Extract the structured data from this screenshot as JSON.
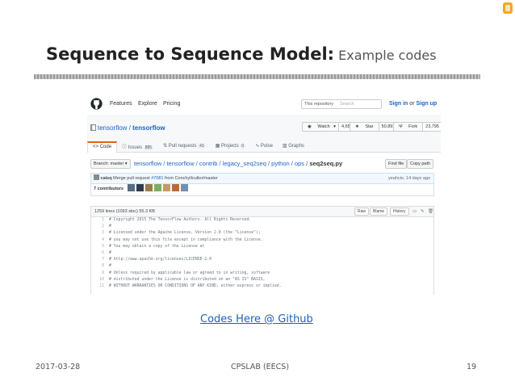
{
  "slide": {
    "title_main": "Sequence to Sequence Model",
    "title_colon": ":",
    "title_sub": " Example codes",
    "link_text": "Codes Here @ Github",
    "footer_date": "2017-03-28",
    "footer_org": "CPSLAB (EECS)",
    "footer_page": "19",
    "accent_color": "#1f5fbf"
  },
  "github": {
    "nav": [
      "Features",
      "Explore",
      "Pricing"
    ],
    "search_scope": "This repository",
    "search_placeholder": "Search",
    "signin": "Sign in",
    "or": "or",
    "signup": "Sign up",
    "repo_owner": "tensorflow",
    "repo_sep": " / ",
    "repo_name": "tensorflow",
    "watch_label": "Watch",
    "watch_count": "4,651",
    "star_label": "Star",
    "star_count": "50,893",
    "fork_label": "Fork",
    "fork_count": "23,795",
    "tabs": [
      {
        "label": "Code",
        "count": ""
      },
      {
        "label": "Issues",
        "count": "885"
      },
      {
        "label": "Pull requests",
        "count": "43"
      },
      {
        "label": "Projects",
        "count": "0"
      },
      {
        "label": "Pulse",
        "count": ""
      },
      {
        "label": "Graphs",
        "count": ""
      }
    ],
    "branch_label": "Branch: master",
    "breadcrumb": [
      "tensorflow",
      "tensorflow",
      "contrib",
      "legacy_seq2seq",
      "python",
      "ops"
    ],
    "breadcrumb_file": "seq2seq.py",
    "find_file": "Find file",
    "copy_path": "Copy path",
    "commit_author": "caisq",
    "commit_msg_prefix": " Merge pull request ",
    "commit_pr": "#7081",
    "commit_msg_suffix": " from ConchylIcultor/master",
    "commit_time": "yeahcio, 14 days ago",
    "contributors": "7 contributors",
    "file_info": "1259 lines (1093 sloc)   55.3 KB",
    "file_buttons": [
      "Raw",
      "Blame",
      "History"
    ],
    "code_lines": [
      {
        "n": "1",
        "t": "# Copyright 2015 The TensorFlow Authors. All Rights Reserved."
      },
      {
        "n": "2",
        "t": "#"
      },
      {
        "n": "3",
        "t": "# Licensed under the Apache License, Version 2.0 (the \"License\");"
      },
      {
        "n": "4",
        "t": "# you may not use this file except in compliance with the License."
      },
      {
        "n": "5",
        "t": "# You may obtain a copy of the License at"
      },
      {
        "n": "6",
        "t": "#"
      },
      {
        "n": "7",
        "t": "#     http://www.apache.org/licenses/LICENSE-2.0"
      },
      {
        "n": "8",
        "t": "#"
      },
      {
        "n": "9",
        "t": "# Unless required by applicable law or agreed to in writing, software"
      },
      {
        "n": "10",
        "t": "# distributed under the License is distributed on an \"AS IS\" BASIS,"
      },
      {
        "n": "11",
        "t": "# WITHOUT WARRANTIES OR CONDITIONS OF ANY KIND, either express or implied."
      }
    ]
  }
}
